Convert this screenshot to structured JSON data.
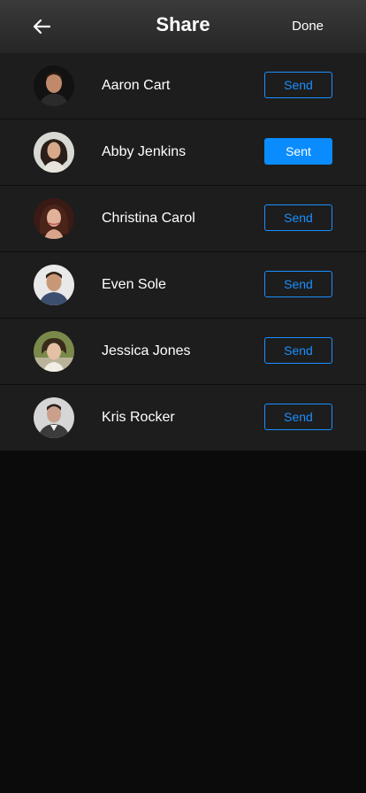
{
  "header": {
    "title": "Share",
    "done_label": "Done",
    "back_icon": "arrow-left-icon"
  },
  "contacts": [
    {
      "name": "Aaron Cart",
      "action": "Send",
      "sent": false
    },
    {
      "name": "Abby Jenkins",
      "action": "Sent",
      "sent": true
    },
    {
      "name": "Christina Carol",
      "action": "Send",
      "sent": false
    },
    {
      "name": "Even Sole",
      "action": "Send",
      "sent": false
    },
    {
      "name": "Jessica Jones",
      "action": "Send",
      "sent": false
    },
    {
      "name": "Kris Rocker",
      "action": "Send",
      "sent": false
    }
  ],
  "colors": {
    "accent": "#0a8cff",
    "row_bg": "#1d1d1d",
    "page_bg": "#0b0b0b"
  }
}
